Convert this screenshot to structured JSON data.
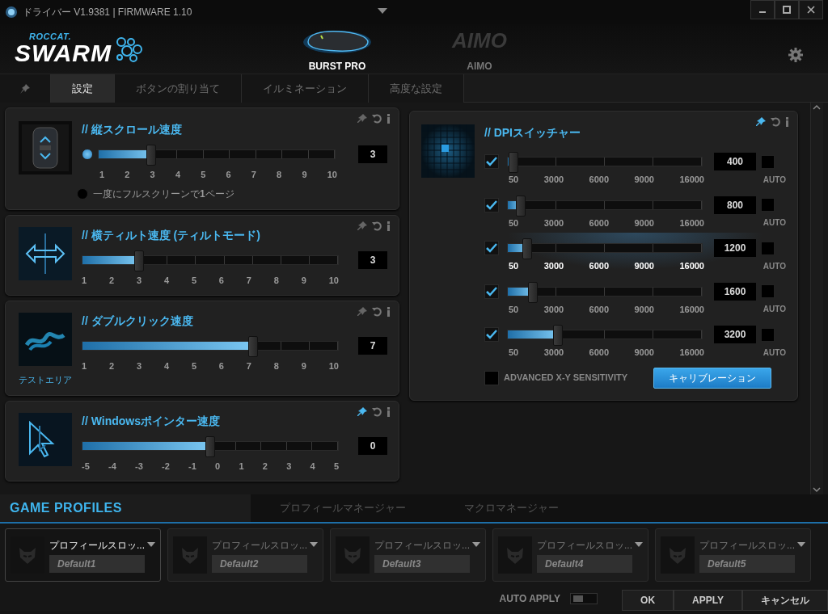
{
  "window": {
    "title": "ドライバー V1.9381 | FIRMWARE 1.10"
  },
  "logo": {
    "brand": "ROCCAT.",
    "product": "SWARM"
  },
  "devices": [
    {
      "kind": "mouse",
      "name": "BURST PRO",
      "selected": true
    },
    {
      "kind": "aimo",
      "logo": "AIMO",
      "name": "AIMO",
      "selected": false
    }
  ],
  "tabs": [
    {
      "kind": "pin",
      "selected": false
    },
    {
      "kind": "text",
      "label": "設定",
      "selected": true
    },
    {
      "kind": "text",
      "label": "ボタンの割り当て",
      "selected": false
    },
    {
      "kind": "text",
      "label": "イルミネーション",
      "selected": false
    },
    {
      "kind": "text",
      "label": "高度な設定",
      "selected": false
    }
  ],
  "settings": [
    {
      "kind": "scroll",
      "title": "// 縦スクロール速度",
      "pinned": false,
      "level": 0.222,
      "value": "3",
      "ticks": [
        "1",
        "2",
        "3",
        "4",
        "5",
        "6",
        "7",
        "8",
        "9",
        "10"
      ],
      "options": [
        {
          "selected": true
        },
        {
          "selected": false,
          "label": "一度にフルスクリーンで**1**ページ"
        }
      ]
    },
    {
      "kind": "slider",
      "title": "// 横ティルト速度 (ティルトモード)",
      "pinned": false,
      "level": 0.222,
      "value": "3",
      "ticks": [
        "1",
        "2",
        "3",
        "4",
        "5",
        "6",
        "7",
        "8",
        "9",
        "10"
      ]
    },
    {
      "kind": "slider",
      "title": "// ダブルクリック速度",
      "caption": "テストエリア",
      "pinned": false,
      "level": 0.667,
      "value": "7",
      "ticks": [
        "1",
        "2",
        "3",
        "4",
        "5",
        "6",
        "7",
        "8",
        "9",
        "10"
      ]
    },
    {
      "kind": "slider",
      "title": "// Windowsポインター速度",
      "pinned": true,
      "level": 0.5,
      "value": "0",
      "ticks": [
        "-5",
        "-4",
        "-3",
        "-2",
        "-1",
        "0",
        "1",
        "2",
        "3",
        "4",
        "5"
      ]
    }
  ],
  "dpi_switcher": {
    "title": "// DPIスイッチャー",
    "pinned": true,
    "rows": [
      {
        "checked": true,
        "level": 0.03,
        "value": "400",
        "auto": false,
        "auto_label": "AUTO",
        "selected": false,
        "ticks": [
          "50",
          "3000",
          "6000",
          "9000",
          "16000"
        ]
      },
      {
        "checked": true,
        "level": 0.065,
        "value": "800",
        "auto": false,
        "auto_label": "AUTO",
        "selected": false,
        "ticks": [
          "50",
          "3000",
          "6000",
          "9000",
          "16000"
        ]
      },
      {
        "checked": true,
        "level": 0.1,
        "value": "1200",
        "auto": false,
        "auto_label": "AUTO",
        "selected": true,
        "ticks": [
          "50",
          "3000",
          "6000",
          "9000",
          "16000"
        ]
      },
      {
        "checked": true,
        "level": 0.13,
        "value": "1600",
        "auto": false,
        "auto_label": "AUTO",
        "selected": false,
        "ticks": [
          "50",
          "3000",
          "6000",
          "9000",
          "16000"
        ]
      },
      {
        "checked": true,
        "level": 0.26,
        "value": "3200",
        "auto": false,
        "auto_label": "AUTO",
        "selected": false,
        "ticks": [
          "50",
          "3000",
          "6000",
          "9000",
          "16000"
        ]
      }
    ],
    "advanced": {
      "label": "ADVANCED X-Y SENSITIVITY",
      "checked": false
    },
    "calibrate_button": "キャリブレーション"
  },
  "profiles": {
    "tabs": [
      {
        "label": "GAME PROFILES",
        "selected": true
      },
      {
        "label": "プロフィールマネージャー",
        "selected": false
      },
      {
        "label": "マクロマネージャー",
        "selected": false
      }
    ],
    "slots": [
      {
        "name": "プロフィールスロッ...",
        "profile": "Default1",
        "selected": true
      },
      {
        "name": "プロフィールスロッ...",
        "profile": "Default2",
        "selected": false
      },
      {
        "name": "プロフィールスロッ...",
        "profile": "Default3",
        "selected": false
      },
      {
        "name": "プロフィールスロッ...",
        "profile": "Default4",
        "selected": false
      },
      {
        "name": "プロフィールスロッ...",
        "profile": "Default5",
        "selected": false
      }
    ]
  },
  "footer": {
    "auto_apply": {
      "label": "AUTO APPLY",
      "on": false
    },
    "buttons": [
      "OK",
      "APPLY",
      "キャンセル"
    ]
  }
}
